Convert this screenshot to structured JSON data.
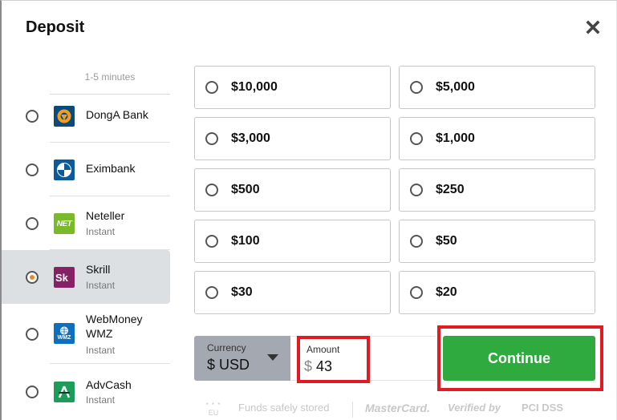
{
  "dialog": {
    "title": "Deposit",
    "close_icon": "close-x-icon"
  },
  "methods": {
    "note": "1-5 minutes",
    "items": [
      {
        "name": "DongA Bank",
        "sub": "",
        "logo": "donga-bank-logo",
        "logo_color": "#0d4a7c",
        "selected": false
      },
      {
        "name": "Eximbank",
        "sub": "",
        "logo": "eximbank-logo",
        "logo_color": "#0b5b9c",
        "selected": false
      },
      {
        "name": "Neteller",
        "sub": "Instant",
        "logo": "neteller-logo",
        "logo_text": "NET",
        "logo_color": "#7ab929",
        "selected": false
      },
      {
        "name": "Skrill",
        "sub": "Instant",
        "logo": "skrill-logo",
        "logo_text": "Sk",
        "logo_color": "#862165",
        "selected": true
      },
      {
        "name": "WebMoney\nWMZ",
        "name_line1": "WebMoney",
        "name_line2": "WMZ",
        "sub": "Instant",
        "logo": "webmoney-logo",
        "logo_text": "WMZ",
        "logo_color": "#0e6fbe",
        "selected": false
      },
      {
        "name": "AdvCash",
        "sub": "Instant",
        "logo": "advcash-logo",
        "logo_text": "A",
        "logo_color": "#1e9c5a",
        "selected": false
      }
    ]
  },
  "amounts": {
    "options": [
      {
        "label": "$10,000",
        "selected": false
      },
      {
        "label": "$5,000",
        "selected": false
      },
      {
        "label": "$3,000",
        "selected": false
      },
      {
        "label": "$1,000",
        "selected": false
      },
      {
        "label": "$500",
        "selected": false
      },
      {
        "label": "$250",
        "selected": false
      },
      {
        "label": "$100",
        "selected": false
      },
      {
        "label": "$50",
        "selected": false
      },
      {
        "label": "$30",
        "selected": false
      },
      {
        "label": "$20",
        "selected": false
      }
    ]
  },
  "currency": {
    "caption": "Currency",
    "value": "$ USD"
  },
  "amount_input": {
    "caption": "Amount",
    "currency_symbol": "$",
    "value": "43"
  },
  "continue_label": "Continue",
  "colors": {
    "accent_green": "#2faa3f",
    "highlight_red": "#e11b22",
    "selected_row": "#dde0e3",
    "radio_dot": "#e8892f"
  },
  "trust": {
    "eu_badge": "EU",
    "funds_text": "Funds safely stored",
    "mastercard": "MasterCard.",
    "verified_by": "Verified by",
    "pci": "PCI DSS"
  }
}
